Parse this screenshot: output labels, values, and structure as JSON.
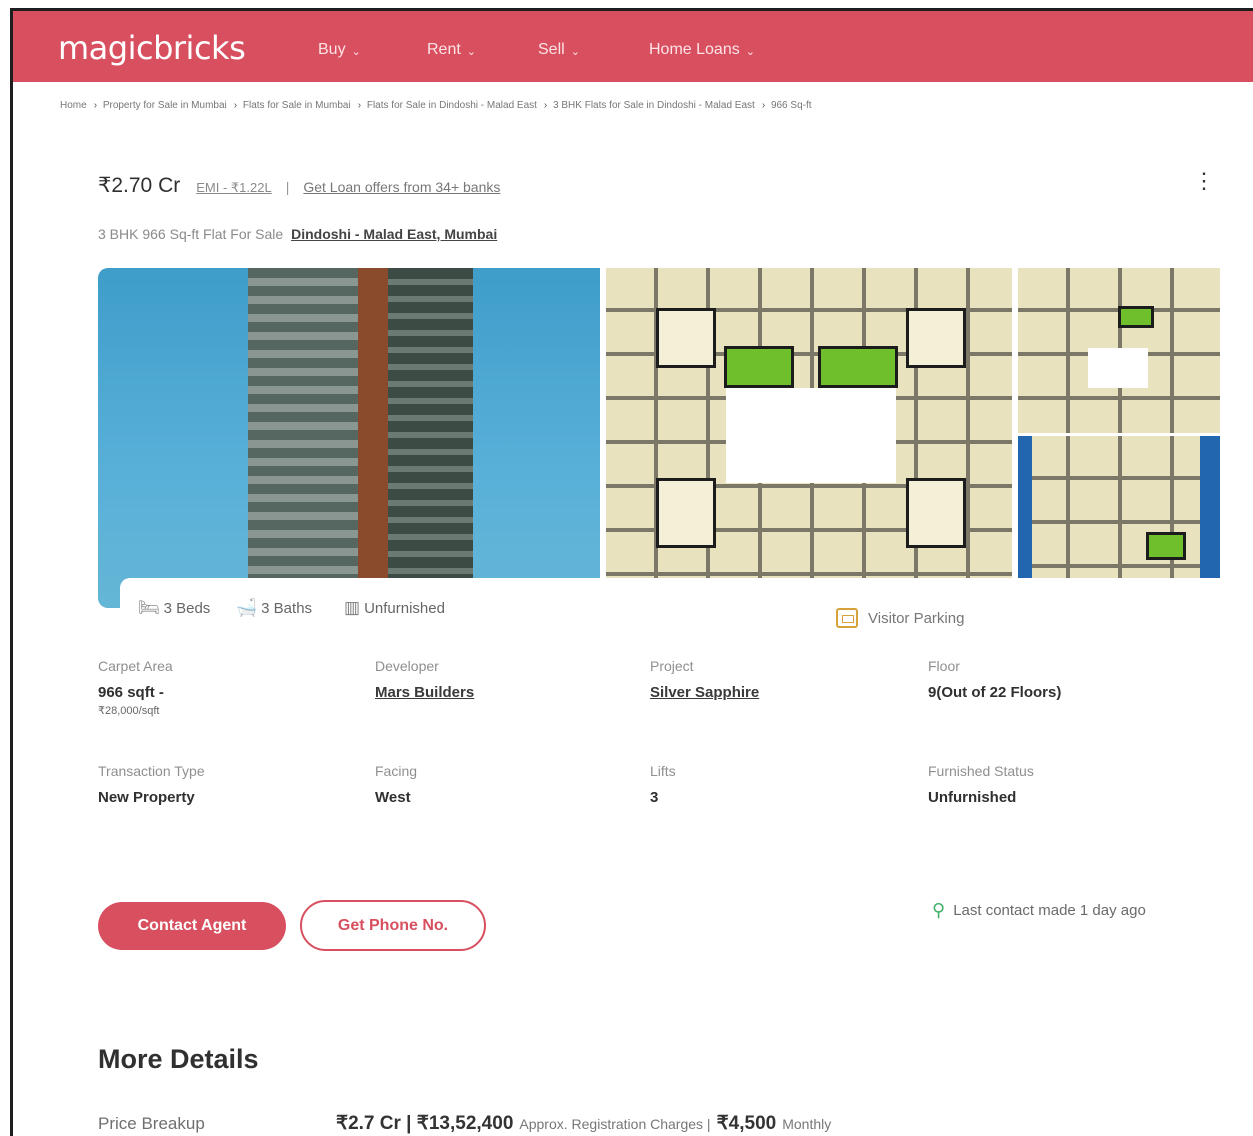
{
  "header": {
    "logo": "magicbricks",
    "nav": [
      {
        "label": "Buy"
      },
      {
        "label": "Rent"
      },
      {
        "label": "Sell"
      },
      {
        "label": "Home Loans"
      }
    ]
  },
  "breadcrumb": [
    "Home",
    "Property for Sale in Mumbai",
    "Flats for Sale in Mumbai",
    "Flats for Sale in Dindoshi - Malad East",
    "3 BHK Flats for Sale in Dindoshi - Malad East",
    "966 Sq-ft"
  ],
  "listing": {
    "price": "₹2.70 Cr",
    "emi": "EMI - ₹1.22L",
    "loan_offer": "Get Loan offers from 34+ banks",
    "subtitle": "3 BHK 966 Sq-ft Flat For Sale",
    "location": "Dindoshi - Malad East, Mumbai"
  },
  "amenities": {
    "beds": "3 Beds",
    "baths": "3 Baths",
    "furnishing": "Unfurnished",
    "visitor_parking": "Visitor Parking"
  },
  "details": [
    {
      "label": "Carpet Area",
      "value": "966 sqft -",
      "sub": "₹28,000/sqft"
    },
    {
      "label": "Developer",
      "value": "Mars Builders"
    },
    {
      "label": "Project",
      "value": "Silver Sapphire"
    },
    {
      "label": "Floor",
      "value": "9(Out of 22 Floors)"
    },
    {
      "label": "Transaction Type",
      "value": "New Property"
    },
    {
      "label": "Facing",
      "value": "West"
    },
    {
      "label": "Lifts",
      "value": "3"
    },
    {
      "label": "Furnished Status",
      "value": "Unfurnished"
    }
  ],
  "actions": {
    "contact_agent": "Contact Agent",
    "get_phone": "Get Phone No.",
    "last_contact": "Last contact made 1 day ago"
  },
  "more_details": {
    "title": "More Details",
    "price_breakup_label": "Price Breakup",
    "price": "₹2.7 Cr | ₹13,52,400",
    "registration": "Approx. Registration Charges |",
    "monthly_amount": "₹4,500",
    "monthly": "Monthly"
  },
  "colors": {
    "brand": "#d8505f",
    "visitor_icon": "#d7a23a",
    "user_icon": "#44b06a"
  }
}
